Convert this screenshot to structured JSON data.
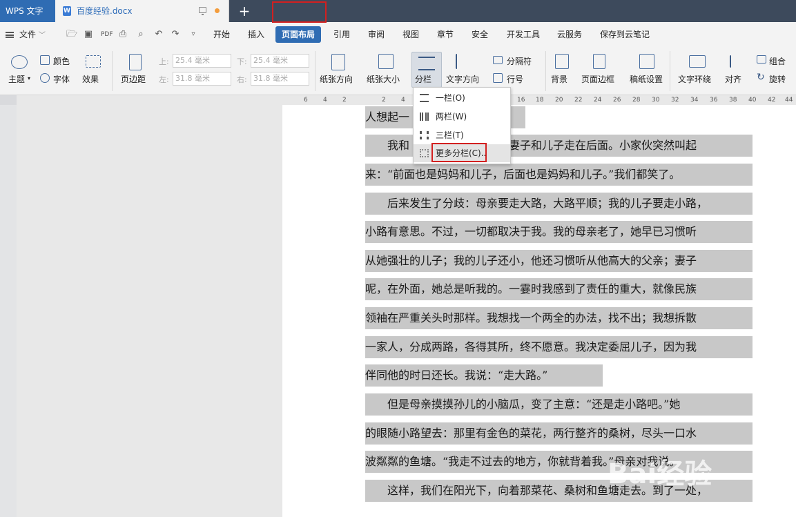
{
  "titlebar": {
    "app_name": "WPS 文字",
    "doc_name": "百度经验.docx",
    "new_tab": "+"
  },
  "menubar": {
    "file": "文件",
    "items": [
      "开始",
      "插入",
      "页面布局",
      "引用",
      "审阅",
      "视图",
      "章节",
      "安全",
      "开发工具",
      "云服务",
      "保存到云笔记"
    ],
    "active": "页面布局"
  },
  "ribbon": {
    "theme": "主题",
    "color": "颜色",
    "font": "字体",
    "effect": "效果",
    "margins": "页边距",
    "top_label": "上:",
    "top_value": "25.4 毫米",
    "bottom_label": "下:",
    "bottom_value": "25.4 毫米",
    "left_label": "左:",
    "left_value": "31.8 毫米",
    "right_label": "右:",
    "right_value": "31.8 毫米",
    "orientation": "纸张方向",
    "size": "纸张大小",
    "columns": "分栏",
    "text_direction": "文字方向",
    "breaks": "分隔符",
    "line_numbers": "行号",
    "background": "背景",
    "page_border": "页面边框",
    "grid_settings": "稿纸设置",
    "wrap": "文字环绕",
    "align": "对齐",
    "group": "组合",
    "rotate": "旋转"
  },
  "ruler": {
    "numbers": [
      "6",
      "4",
      "2",
      "",
      "2",
      "4",
      "",
      "",
      "",
      "",
      "",
      "",
      "16",
      "18",
      "20",
      "22",
      "24",
      "26",
      "28",
      "30",
      "32",
      "34",
      "36",
      "38",
      "40",
      "42",
      "44"
    ]
  },
  "columns_menu": {
    "items": [
      {
        "label": "一栏(O)",
        "icon": "one-column-icon"
      },
      {
        "label": "两栏(W)",
        "icon": "two-column-icon"
      },
      {
        "label": "三栏(T)",
        "icon": "three-column-icon"
      },
      {
        "label": "更多分栏(C)..",
        "icon": "more-columns-icon"
      }
    ]
  },
  "document": {
    "lines": [
      "人想起一",
      "　　我和",
      "来：“前面也是妈妈和儿子，后面也是妈妈和儿子。”我们都笑了。",
      "　　后来发生了分歧：母亲要走大路，大路平顺；我的儿子要走小路，",
      "小路有意思。不过，一切都取决于我。我的母亲老了，她早已习惯听",
      "从她强壮的儿子；我的儿子还小，他还习惯听从他高大的父亲；妻子",
      "呢，在外面，她总是听我的。一霎时我感到了责任的重大，就像民族",
      "领袖在严重关头时那样。我想找一个两全的办法，找不出；我想拆散",
      "一家人，分成两路，各得其所，终不愿意。我决定委屈儿子，因为我",
      "伴同他的时日还长。我说：“走大路。”",
      "　　但是母亲摸摸孙儿的小脑瓜，变了主意：“还是走小路吧。”她",
      "的眼随小路望去：那里有金色的菜花，两行整齐的桑树，尽头一口水",
      "波粼粼的鱼塘。“我走不过去的地方，你就背着我。”母亲对我说。",
      "　　这样，我们在阳光下，向着那菜花、桑树和鱼塘走去。到了一处，"
    ],
    "line1_tail": "我的妻子和儿子走在后面。小家伙突然叫起"
  },
  "watermark": "Bai经验"
}
